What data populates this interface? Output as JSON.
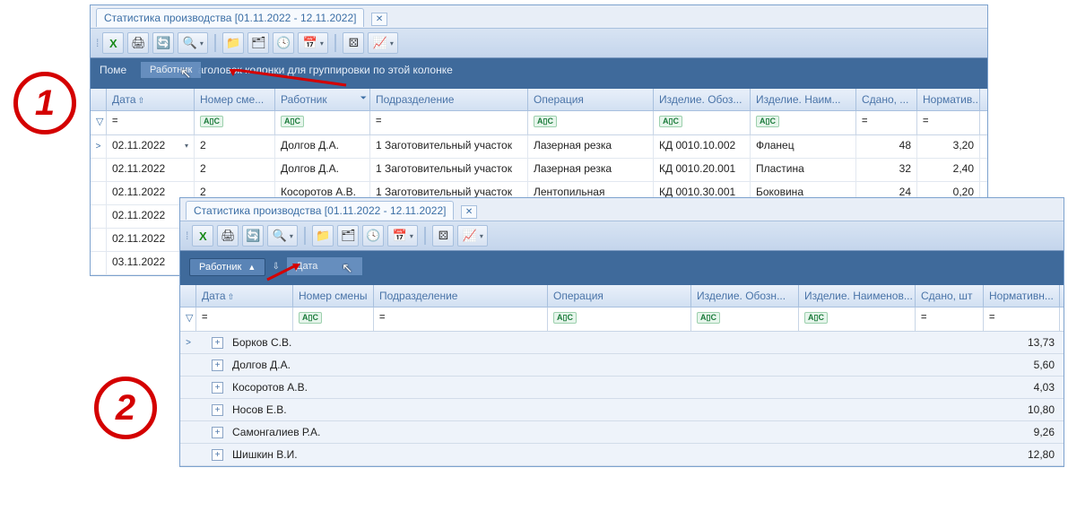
{
  "window1": {
    "tab_title": "Статистика производства [01.11.2022 - 12.11.2022]",
    "group_hint_left": "Поме",
    "group_hint_rest": "аголовок колонки для группировки по этой колонке",
    "drag_ghost": "Работник",
    "cols": {
      "date": "Дата",
      "shift": "Номер сме...",
      "worker": "Работник",
      "dept": "Подразделение",
      "op": "Операция",
      "prodcode": "Изделие. Обоз...",
      "prodname": "Изделие. Наим...",
      "done": "Сдано, ...",
      "norm": "Норматив..."
    },
    "filter_eq": "=",
    "filter_abc": "A▯C",
    "rows": [
      {
        "ind": ">",
        "date": "02.11.2022",
        "shift": "2",
        "worker": "Долгов Д.А.",
        "dept": "1 Заготовительный участок",
        "op": "Лазерная резка",
        "prodcode": "КД 0010.10.002",
        "prodname": "Фланец",
        "done": "48",
        "norm": "3,20",
        "dd": true
      },
      {
        "ind": "",
        "date": "02.11.2022",
        "shift": "2",
        "worker": "Долгов Д.А.",
        "dept": "1 Заготовительный участок",
        "op": "Лазерная резка",
        "prodcode": "КД 0010.20.001",
        "prodname": "Пластина",
        "done": "32",
        "norm": "2,40"
      },
      {
        "ind": "",
        "date": "02.11.2022",
        "shift": "2",
        "worker": "Косоротов А.В.",
        "dept": "1 Заготовительный участок",
        "op": "Лентопильная",
        "prodcode": "КД 0010.30.001",
        "prodname": "Боковина",
        "done": "24",
        "norm": "0,20"
      },
      {
        "ind": "",
        "date": "02.11.2022",
        "shift": "",
        "worker": "",
        "dept": "",
        "op": "",
        "prodcode": "",
        "prodname": "",
        "done": "",
        "norm": ""
      },
      {
        "ind": "",
        "date": "02.11.2022",
        "shift": "",
        "worker": "",
        "dept": "",
        "op": "",
        "prodcode": "",
        "prodname": "",
        "done": "",
        "norm": ""
      },
      {
        "ind": "",
        "date": "03.11.2022",
        "shift": "",
        "worker": "",
        "dept": "",
        "op": "",
        "prodcode": "",
        "prodname": "",
        "done": "",
        "norm": ""
      }
    ]
  },
  "window2": {
    "tab_title": "Статистика производства [01.11.2022 - 12.11.2022]",
    "chip1": "Работник",
    "drag_ghost": "Дата",
    "cols": {
      "date": "Дата",
      "shift": "Номер смены",
      "dept": "Подразделение",
      "op": "Операция",
      "prodcode": "Изделие. Обозн...",
      "prodname": "Изделие. Наименов...",
      "done": "Сдано, шт",
      "norm": "Нормативн..."
    },
    "filter_eq": "=",
    "filter_abc": "A▯C",
    "groups": [
      {
        "ind": ">",
        "worker": "Борков С.В.",
        "norm": "13,73"
      },
      {
        "ind": "",
        "worker": "Долгов Д.А.",
        "norm": "5,60"
      },
      {
        "ind": "",
        "worker": "Косоротов А.В.",
        "norm": "4,03"
      },
      {
        "ind": "",
        "worker": "Носов Е.В.",
        "norm": "10,80"
      },
      {
        "ind": "",
        "worker": "Самонгалиев Р.А.",
        "norm": "9,26"
      },
      {
        "ind": "",
        "worker": "Шишкин В.И.",
        "norm": "12,80"
      }
    ]
  },
  "icons": {
    "excel": "X",
    "print": "🖨",
    "refresh": "🔄",
    "zoom": "🔍",
    "folder": "📁",
    "docs": "🗂",
    "clock": "🕓",
    "calendar": "📅",
    "dots": "⚄",
    "chart": "📈"
  },
  "labels": {
    "circle1": "1",
    "circle2": "2"
  }
}
